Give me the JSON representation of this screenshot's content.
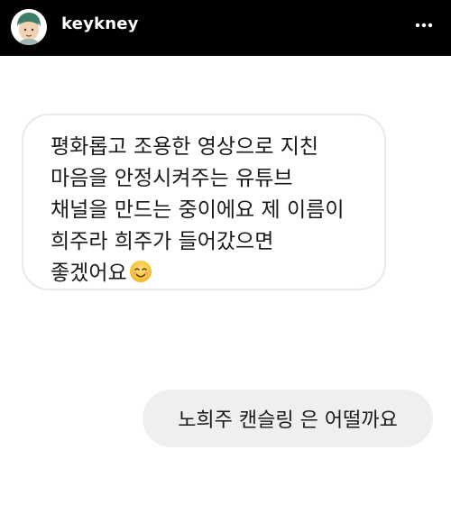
{
  "header": {
    "username": "keykney",
    "avatar_icon": "cartoon-face-avatar",
    "more_icon": "more-dots-icon"
  },
  "messages": {
    "received": {
      "lines": [
        "평화롭고 조용한 영상으로 지친",
        "마음을 안정시켜주는 유튜브",
        "채널을 만드는 중이에요 제 이름이",
        "희주라 희주가 들어갔으면",
        "좋겠어요"
      ],
      "emoji": "smiling-face-emoji"
    },
    "sent": {
      "text": "노희주 캔슬링 은 어떨까요"
    }
  },
  "colors": {
    "header_bg": "#000000",
    "bubble_out_bg": "#efefef",
    "bubble_in_border": "#e9e9e9"
  }
}
